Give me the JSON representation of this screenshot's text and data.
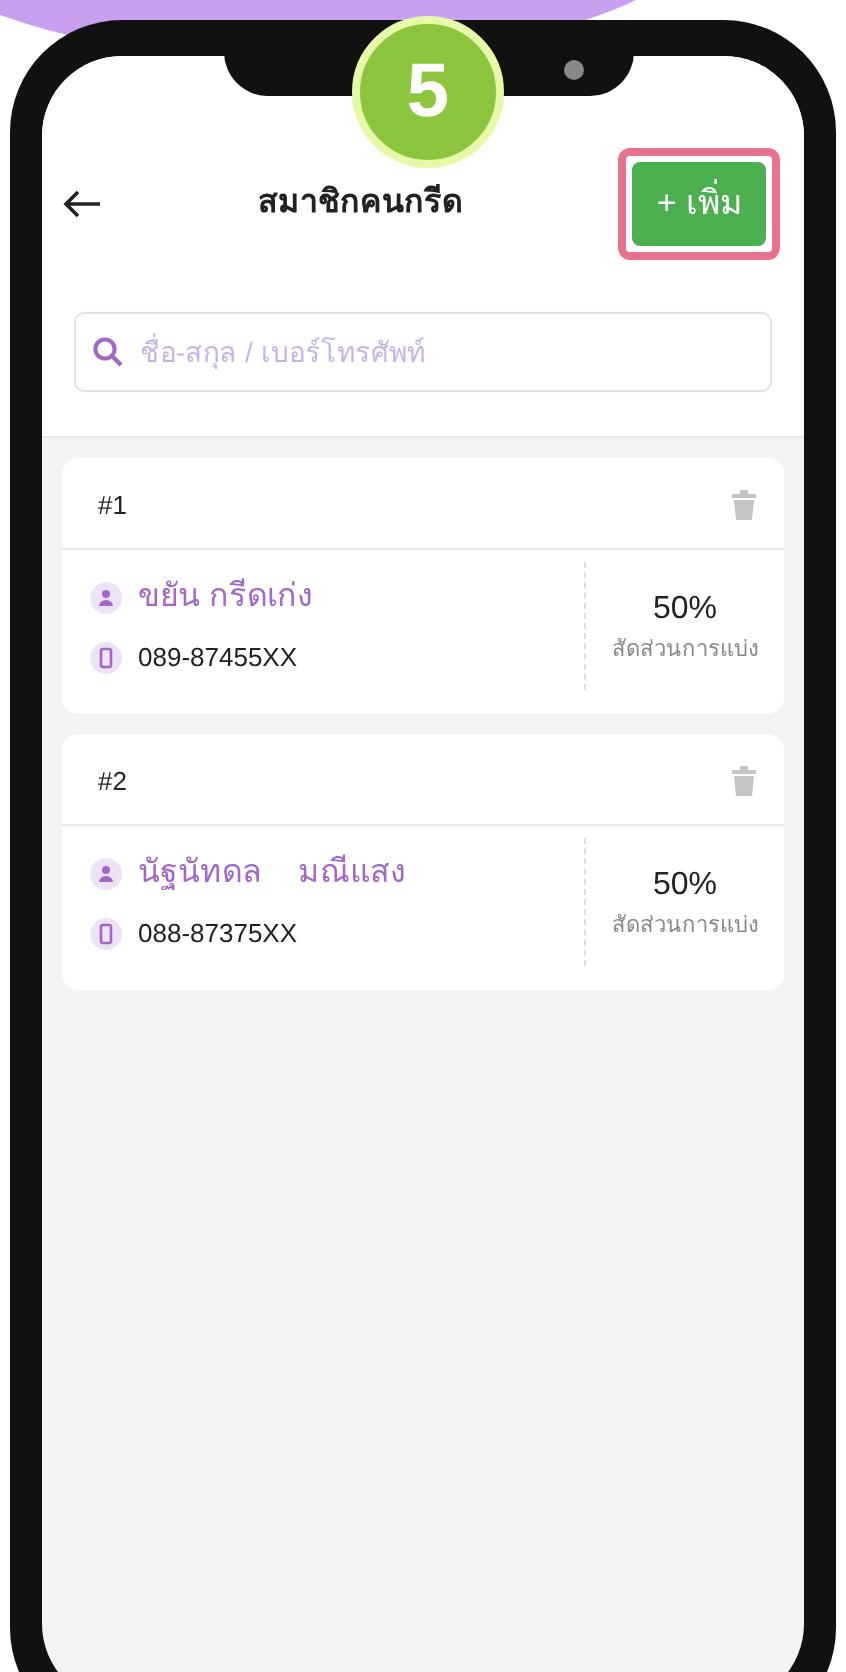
{
  "step_badge": "5",
  "header": {
    "title": "สมาชิกคนกรีด",
    "add_button": "+ เพิ่ม",
    "add_button_highlighted": true
  },
  "search": {
    "placeholder": "ชื่อ-สกุล / เบอร์โทรศัพท์"
  },
  "members": [
    {
      "number": "#1",
      "name": "ขยัน กรีดเก่ง",
      "phone": "089-87455XX",
      "share": "50%",
      "share_label": "สัดส่วนการแบ่ง"
    },
    {
      "number": "#2",
      "name": "นัฐนัทดล    มณีแสง",
      "phone": "088-87375XX",
      "share": "50%",
      "share_label": "สัดส่วนการแบ่ง"
    }
  ]
}
